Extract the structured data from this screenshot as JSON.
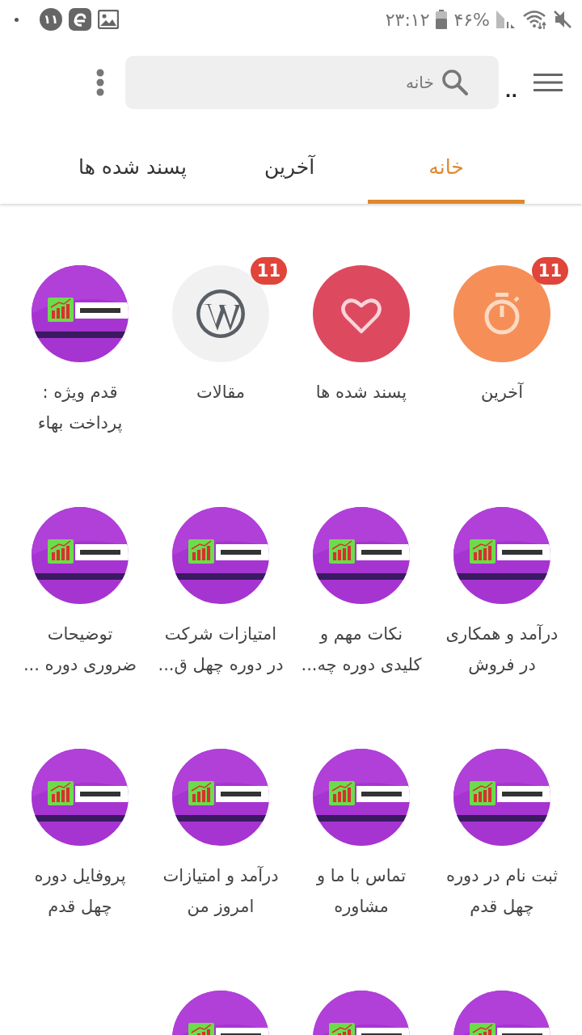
{
  "status_bar": {
    "time": "۲۳:۱۲",
    "battery": "۴۶%",
    "notification_count": "۱۱"
  },
  "toolbar": {
    "title": "..",
    "search": {
      "placeholder": "خانه"
    }
  },
  "tabs": [
    {
      "label": "خانه",
      "selected": true
    },
    {
      "label": "آخرین",
      "selected": false
    },
    {
      "label": "پسند شده ها",
      "selected": false
    }
  ],
  "grid": [
    {
      "kind": "timer",
      "badge": "11",
      "lines": [
        "آخرین"
      ]
    },
    {
      "kind": "heart",
      "lines": [
        "پسند شده ها"
      ]
    },
    {
      "kind": "wordpress",
      "badge": "11",
      "lines": [
        "مقالات"
      ]
    },
    {
      "kind": "picture",
      "lines": [
        "قدم ویژه :",
        "پرداخت بهاء"
      ]
    },
    {
      "kind": "picture",
      "lines": [
        "درآمد و همکاری",
        "در فروش"
      ]
    },
    {
      "kind": "picture",
      "lines": [
        "نکات مهم و",
        "کلیدی دوره چه..."
      ]
    },
    {
      "kind": "picture",
      "lines": [
        "امتیازات شرکت",
        "در دوره چهل ق..."
      ]
    },
    {
      "kind": "picture",
      "lines": [
        "توضیحات",
        "ضروری دوره ..."
      ]
    },
    {
      "kind": "picture",
      "lines": [
        "ثبت نام در دوره",
        "چهل قدم"
      ]
    },
    {
      "kind": "picture",
      "lines": [
        "تماس با ما و",
        "مشاوره"
      ]
    },
    {
      "kind": "picture",
      "lines": [
        "درآمد و امتیازات",
        "امروز من"
      ]
    },
    {
      "kind": "picture",
      "lines": [
        "پروفایل دوره",
        "چهل قدم"
      ]
    },
    {
      "kind": "picture"
    },
    {
      "kind": "picture"
    },
    {
      "kind": "picture"
    }
  ]
}
